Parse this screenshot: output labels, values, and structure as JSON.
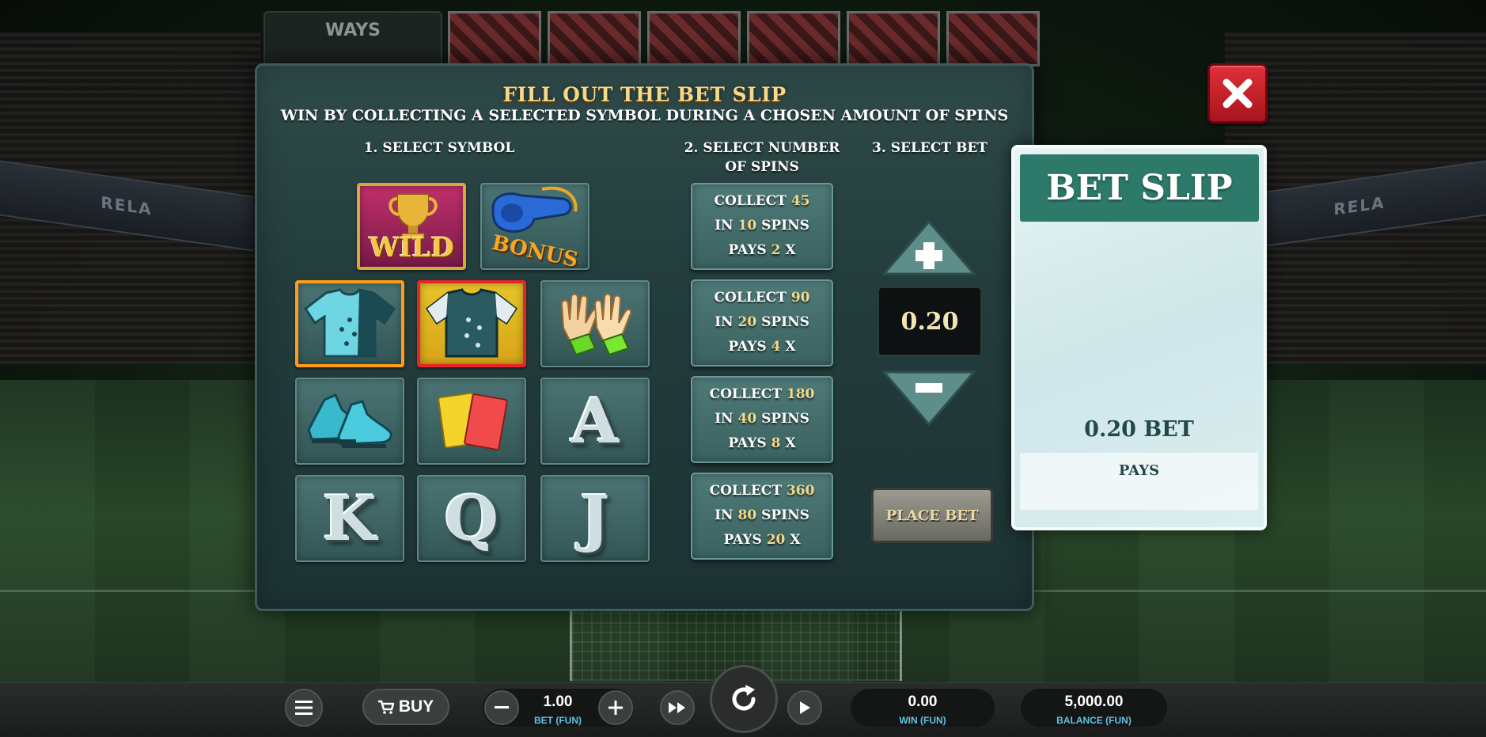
{
  "background": {
    "ways_label": "WAYS",
    "stand_board_left": "RELA",
    "stand_board_right": "RELA"
  },
  "dialog": {
    "title": "FILL OUT THE BET SLIP",
    "subtitle": "WIN BY COLLECTING A SELECTED SYMBOL DURING A CHOSEN AMOUNT OF SPINS",
    "col1_heading": "1. SELECT SYMBOL",
    "col2_heading_line1": "2. SELECT NUMBER",
    "col2_heading_line2": "OF SPINS",
    "col3_heading": "3. SELECT BET"
  },
  "symbols": {
    "wild_label": "WILD",
    "bonus_label": "BONUS",
    "letters": [
      "A",
      "K",
      "Q",
      "J"
    ]
  },
  "spins_options": [
    {
      "collect_word": "COLLECT",
      "collect": "45",
      "in_word": "IN",
      "spins": "10",
      "spins_word": "SPINS",
      "pays_word": "PAYS",
      "pays": "2",
      "x": "X"
    },
    {
      "collect_word": "COLLECT",
      "collect": "90",
      "in_word": "IN",
      "spins": "20",
      "spins_word": "SPINS",
      "pays_word": "PAYS",
      "pays": "4",
      "x": "X"
    },
    {
      "collect_word": "COLLECT",
      "collect": "180",
      "in_word": "IN",
      "spins": "40",
      "spins_word": "SPINS",
      "pays_word": "PAYS",
      "pays": "8",
      "x": "X"
    },
    {
      "collect_word": "COLLECT",
      "collect": "360",
      "in_word": "IN",
      "spins": "80",
      "spins_word": "SPINS",
      "pays_word": "PAYS",
      "pays": "20",
      "x": "X"
    }
  ],
  "bet_control": {
    "value": "0.20",
    "place_bet_label": "PLACE BET"
  },
  "bet_slip": {
    "header": "BET SLIP",
    "bet_line": "0.20 BET",
    "pays_label": "PAYS"
  },
  "bottom_bar": {
    "buy_label": "BUY",
    "bet_value": "1.00",
    "bet_label": "BET (FUN)",
    "win_value": "0.00",
    "win_label": "WIN (FUN)",
    "balance_value": "5,000.00",
    "balance_label": "BALANCE (FUN)"
  },
  "colors": {
    "dialog_bg": "#233c3c",
    "title_gold": "#f3d98a",
    "slip_header": "#2d7a6a",
    "close_red": "#e03038",
    "label_blue": "#62c0e6",
    "selected_orange": "#ff9c1a",
    "selected_red": "#e8232a"
  },
  "icons": [
    "hamburger-menu-icon",
    "cart-icon",
    "minus-icon",
    "plus-icon",
    "fast-forward-icon",
    "spin-icon",
    "play-icon",
    "close-icon",
    "trophy-icon",
    "whistle-icon",
    "jersey-icon",
    "gloves-icon",
    "boots-icon",
    "cards-icon"
  ]
}
